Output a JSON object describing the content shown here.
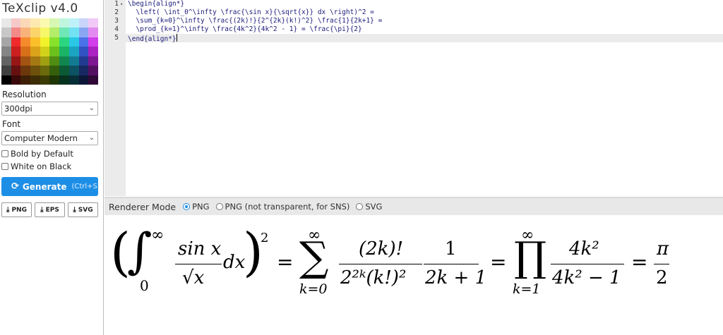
{
  "app": {
    "title": "TeXclip v4.0"
  },
  "palette": [
    [
      "#e8e8e8",
      "#f6c9c9",
      "#fbd9b8",
      "#fde9b0",
      "#fbfbb0",
      "#d8f7b2",
      "#bff5dc",
      "#bff1f9",
      "#c9d5fb",
      "#f1c9f7"
    ],
    [
      "#c8c8c8",
      "#f38a8a",
      "#f8b27a",
      "#fbd56a",
      "#f7f76a",
      "#b3ed69",
      "#6fe7b6",
      "#72e1f2",
      "#8aa6f3",
      "#e38af0"
    ],
    [
      "#a6a6a6",
      "#ee2a2a",
      "#f58a2d",
      "#f9c02a",
      "#f2f22a",
      "#86e22a",
      "#2ad67f",
      "#2ac7e6",
      "#4b71ea",
      "#d23ee9"
    ],
    [
      "#858585",
      "#cc1f1f",
      "#d86f19",
      "#dba31a",
      "#d2d21a",
      "#6cc01b",
      "#1bb467",
      "#1ba4c2",
      "#3152c2",
      "#ab22c2"
    ],
    [
      "#636363",
      "#981616",
      "#a35312",
      "#a47912",
      "#9f9f12",
      "#508d12",
      "#128650",
      "#127b92",
      "#223b92",
      "#7f1692"
    ],
    [
      "#404040",
      "#661010",
      "#6d370c",
      "#6d510c",
      "#6a6a0c",
      "#355e0c",
      "#0c5935",
      "#0c5262",
      "#172862",
      "#550f62"
    ],
    [
      "#000000",
      "#3a0808",
      "#3d1f06",
      "#3d2d06",
      "#3b3b06",
      "#1e3506",
      "#06321e",
      "#062e37",
      "#0c1637",
      "#2f0837"
    ]
  ],
  "settings": {
    "resolution_label": "Resolution",
    "resolution_value": "300dpi",
    "font_label": "Font",
    "font_value": "Computer Modern",
    "bold_label": "Bold by Default",
    "white_label": "White on Black",
    "generate_label": "Generate",
    "generate_shortcut": "(Ctrl+S)",
    "downloads": [
      "PNG",
      "EPS",
      "SVG"
    ]
  },
  "editor": {
    "lines": [
      {
        "n": "1",
        "code": "\\begin{align*}"
      },
      {
        "n": "2",
        "code": "  \\left( \\int_0^\\infty \\frac{\\sin x}{\\sqrt{x}} dx \\right)^2 ="
      },
      {
        "n": "3",
        "code": "  \\sum_{k=0}^\\infty \\frac{(2k)!}{2^{2k}(k!)^2} \\frac{1}{2k+1} ="
      },
      {
        "n": "4",
        "code": "  \\prod_{k=1}^\\infty \\frac{4k^2}{4k^2 - 1} = \\frac{\\pi}{2}"
      },
      {
        "n": "5",
        "code": "\\end{align*}"
      }
    ]
  },
  "renderer": {
    "label": "Renderer Mode",
    "options": [
      "PNG",
      "PNG (not transparent, for SNS)",
      "SVG"
    ],
    "selected": "PNG"
  },
  "preview": {
    "int_upper": "∞",
    "int_lower": "0",
    "frac1_num": "sin x",
    "frac1_den": "√x",
    "dx": "dx",
    "sq": "2",
    "eq": "=",
    "sum_upper": "∞",
    "sum_lower": "k=0",
    "frac2_num": "(2k)!",
    "frac2_den": "2²ᵏ(k!)²",
    "frac3_num": "1",
    "frac3_den": "2k + 1",
    "prod_upper": "∞",
    "prod_lower": "k=1",
    "frac4_num": "4k²",
    "frac4_den": "4k² − 1",
    "frac5_num": "π",
    "frac5_den": "2"
  }
}
